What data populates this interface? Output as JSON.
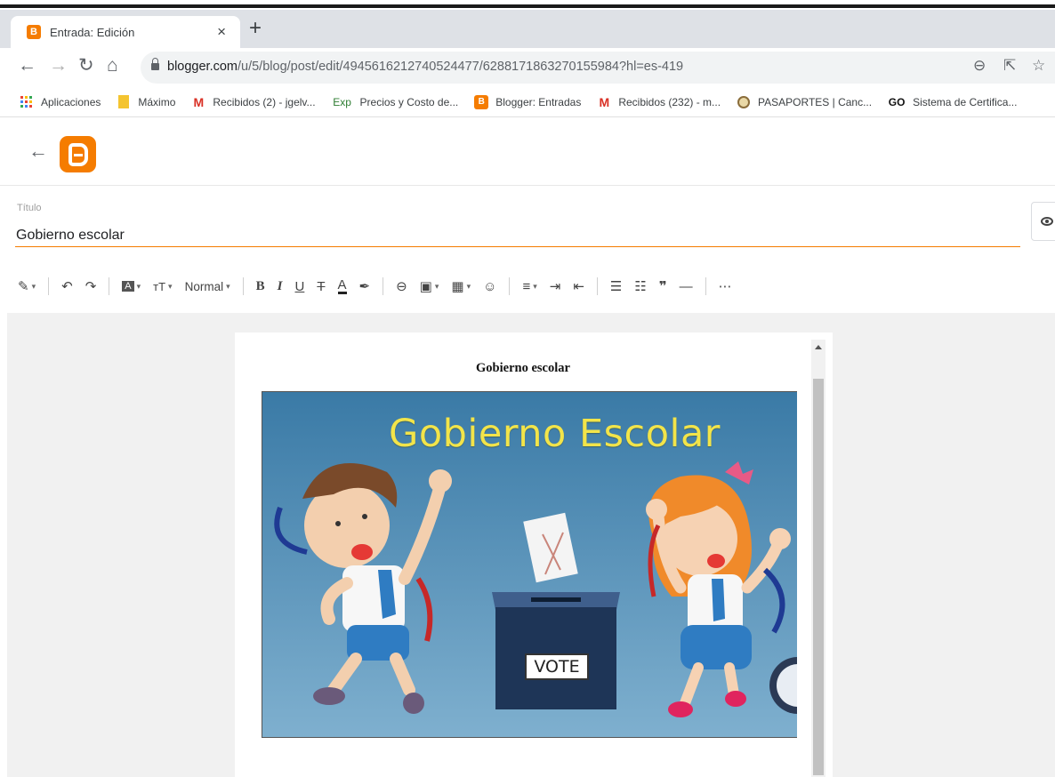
{
  "browser": {
    "tab_title": "Entrada: Edición",
    "tab_close": "×",
    "new_tab": "+",
    "url_domain": "blogger.com",
    "url_path": "/u/5/blog/post/edit/4945616212740524477/6288171863270155984?hl=es-419"
  },
  "bookmarks": [
    {
      "label": "Aplicaciones",
      "icon": "apps-grid-icon"
    },
    {
      "label": "Máximo",
      "icon": "bookmark-folder-icon"
    },
    {
      "label": "Recibidos (2) - jgelv...",
      "icon": "gmail-icon"
    },
    {
      "label": "Precios y Costo de...",
      "icon": "exp-icon",
      "icon_text": "Exp"
    },
    {
      "label": "Blogger: Entradas",
      "icon": "blogger-icon",
      "icon_text": "B"
    },
    {
      "label": "Recibidos (232) - m...",
      "icon": "gmail-icon"
    },
    {
      "label": "PASAPORTES | Canc...",
      "icon": "seal-icon"
    },
    {
      "label": "Sistema de Certifica...",
      "icon": "go-icon",
      "icon_text": "GO"
    }
  ],
  "editor": {
    "title_label": "Título",
    "title_value": "Gobierno escolar",
    "format_normal": "Normal",
    "post_heading": "Gobierno escolar",
    "image_title": "Gobierno Escolar",
    "vote_label": "VOTE"
  },
  "colors": {
    "blogger_orange": "#f57c00",
    "accent_underline": "#f57c00",
    "image_title": "#f2e44a",
    "image_bg": "#3d7fab"
  }
}
